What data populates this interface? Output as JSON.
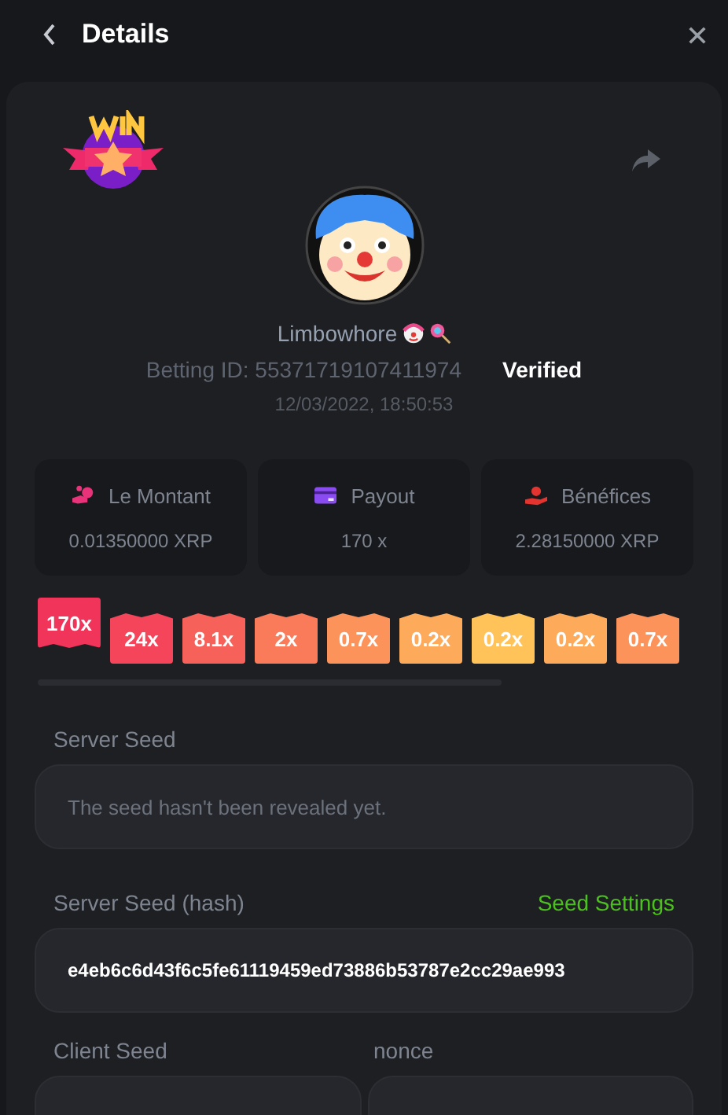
{
  "header": {
    "title": "Details"
  },
  "bet": {
    "username": "Limbowhore",
    "betting_id": "Betting ID: 55371719107411974",
    "status": "Verified",
    "time": "12/03/2022, 18:50:53"
  },
  "stats": [
    {
      "kind": "amount",
      "label": "Le Montant",
      "value": "0.01350000 XRP"
    },
    {
      "kind": "payout",
      "label": "Payout",
      "value": "170 x"
    },
    {
      "kind": "profit",
      "label": "Bénéfices",
      "value": "2.28150000 XRP"
    }
  ],
  "multipliers": [
    {
      "label": "170x",
      "selected": true,
      "color": "#f0345a"
    },
    {
      "label": "24x",
      "selected": false,
      "color": "#f4455a"
    },
    {
      "label": "8.1x",
      "selected": false,
      "color": "#f6615a"
    },
    {
      "label": "2x",
      "selected": false,
      "color": "#f97b5a"
    },
    {
      "label": "0.7x",
      "selected": false,
      "color": "#fb935a"
    },
    {
      "label": "0.2x",
      "selected": false,
      "color": "#fdab5a"
    },
    {
      "label": "0.2x",
      "selected": false,
      "color": "#ffc35a"
    },
    {
      "label": "0.2x",
      "selected": false,
      "color": "#fdab5a"
    },
    {
      "label": "0.7x",
      "selected": false,
      "color": "#fb935a"
    }
  ],
  "server_seed": {
    "label": "Server Seed",
    "placeholder": "The seed hasn't been revealed yet."
  },
  "server_seed_hash": {
    "label": "Server Seed (hash)",
    "link": "Seed Settings",
    "value": "e4eb6c6d43f6c5fe61119459ed73886b53787e2cc29ae993"
  },
  "client_seed": {
    "label": "Client Seed"
  },
  "nonce": {
    "label": "nonce"
  }
}
